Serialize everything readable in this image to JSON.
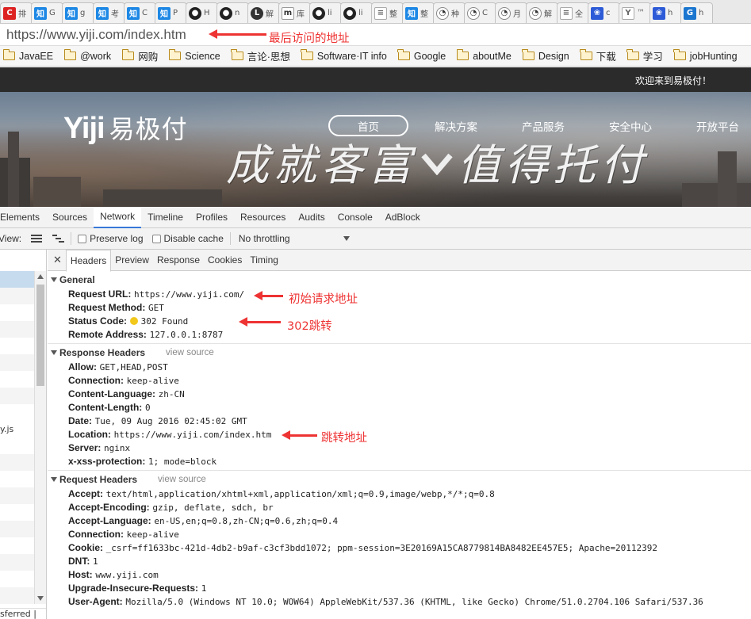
{
  "tabs": [
    {
      "icon": "c-icon",
      "cls": "c",
      "glyph": "C",
      "label": "排"
    },
    {
      "icon": "zhihu-icon",
      "cls": "zh",
      "glyph": "知",
      "label": "G"
    },
    {
      "icon": "zhihu-icon",
      "cls": "zh",
      "glyph": "知",
      "label": "g"
    },
    {
      "icon": "zhihu-icon",
      "cls": "zh",
      "glyph": "知",
      "label": "考"
    },
    {
      "icon": "zhihu-icon",
      "cls": "zh",
      "glyph": "知",
      "label": "C"
    },
    {
      "icon": "zhihu-icon",
      "cls": "zh",
      "glyph": "知",
      "label": "P"
    },
    {
      "icon": "github-icon",
      "cls": "gh",
      "glyph": "●",
      "label": "H"
    },
    {
      "icon": "github-icon",
      "cls": "gh",
      "glyph": "●",
      "label": "n"
    },
    {
      "icon": "l-icon",
      "cls": "l",
      "glyph": "L",
      "label": "解"
    },
    {
      "icon": "m-icon",
      "cls": "m",
      "glyph": "m",
      "label": "库"
    },
    {
      "icon": "github-icon",
      "cls": "gh",
      "glyph": "●",
      "label": "li"
    },
    {
      "icon": "github-icon",
      "cls": "gh",
      "glyph": "●",
      "label": "li"
    },
    {
      "icon": "document-icon",
      "cls": "doc",
      "glyph": "≡",
      "label": "整"
    },
    {
      "icon": "zhihu-icon",
      "cls": "zh",
      "glyph": "知",
      "label": "整"
    },
    {
      "icon": "penguin-icon",
      "cls": "peng",
      "glyph": "◔",
      "label": "种"
    },
    {
      "icon": "penguin-icon",
      "cls": "peng",
      "glyph": "◔",
      "label": "C"
    },
    {
      "icon": "penguin-icon",
      "cls": "peng",
      "glyph": "◔",
      "label": "月"
    },
    {
      "icon": "penguin-icon",
      "cls": "peng",
      "glyph": "◔",
      "label": "解"
    },
    {
      "icon": "document-icon",
      "cls": "doc",
      "glyph": "≡",
      "label": "全"
    },
    {
      "icon": "baidu-icon",
      "cls": "baidu",
      "glyph": "❀",
      "label": "c"
    },
    {
      "icon": "y-icon",
      "cls": "doc",
      "glyph": "Y",
      "label": "™"
    },
    {
      "icon": "baidu-icon",
      "cls": "baidu",
      "glyph": "❀",
      "label": "h"
    },
    {
      "icon": "g-icon",
      "cls": "g",
      "glyph": "G",
      "label": "h"
    }
  ],
  "address": {
    "url": "https://www.yiji.com/index.htm"
  },
  "bookmarks": [
    "JavaEE",
    "@work",
    "网购",
    "Science",
    "言论·思想",
    "Software·IT info",
    "Google",
    "aboutMe",
    "Design",
    "下载",
    "学习",
    "jobHunting"
  ],
  "site": {
    "welcome": "欢迎来到易极付！",
    "logo_latin": "Yiji",
    "logo_cn": "易极付",
    "nav": [
      "首页",
      "解决方案",
      "产品服务",
      "安全中心",
      "开放平台"
    ],
    "slogan_left": "成就客富",
    "slogan_right": "值得托付"
  },
  "devtools": {
    "tabs": [
      "Elements",
      "Sources",
      "Network",
      "Timeline",
      "Profiles",
      "Resources",
      "Audits",
      "Console",
      "AdBlock"
    ],
    "view_label": "View:",
    "preserve_log": "Preserve log",
    "disable_cache": "Disable cache",
    "throttling": "No throttling",
    "left_js": "y.js",
    "left_status": "sferred |",
    "subtabs": [
      "Headers",
      "Preview",
      "Response",
      "Cookies",
      "Timing"
    ],
    "general": {
      "title": "General",
      "rows": [
        {
          "k": "Request URL:",
          "v": "https://www.yiji.com/"
        },
        {
          "k": "Request Method:",
          "v": "GET"
        },
        {
          "k": "Status Code:",
          "v": "302 Found"
        },
        {
          "k": "Remote Address:",
          "v": "127.0.0.1:8787"
        }
      ]
    },
    "response": {
      "title": "Response Headers",
      "view_source": "view source",
      "rows": [
        {
          "k": "Allow:",
          "v": "GET,HEAD,POST"
        },
        {
          "k": "Connection:",
          "v": "keep-alive"
        },
        {
          "k": "Content-Language:",
          "v": "zh-CN"
        },
        {
          "k": "Content-Length:",
          "v": "0"
        },
        {
          "k": "Date:",
          "v": "Tue, 09 Aug 2016 02:45:02 GMT"
        },
        {
          "k": "Location:",
          "v": "https://www.yiji.com/index.htm"
        },
        {
          "k": "Server:",
          "v": "nginx"
        },
        {
          "k": "x-xss-protection:",
          "v": "1; mode=block"
        }
      ]
    },
    "request": {
      "title": "Request Headers",
      "view_source": "view source",
      "rows": [
        {
          "k": "Accept:",
          "v": "text/html,application/xhtml+xml,application/xml;q=0.9,image/webp,*/*;q=0.8"
        },
        {
          "k": "Accept-Encoding:",
          "v": "gzip, deflate, sdch, br"
        },
        {
          "k": "Accept-Language:",
          "v": "en-US,en;q=0.8,zh-CN;q=0.6,zh;q=0.4"
        },
        {
          "k": "Connection:",
          "v": "keep-alive"
        },
        {
          "k": "Cookie:",
          "v": "_csrf=ff1633bc-421d-4db2-b9af-c3cf3bdd1072; ppm-session=3E20169A15CA8779814BA8482EE457E5; Apache=20112392"
        },
        {
          "k": "DNT:",
          "v": "1"
        },
        {
          "k": "Host:",
          "v": "www.yiji.com"
        },
        {
          "k": "Upgrade-Insecure-Requests:",
          "v": "1"
        },
        {
          "k": "User-Agent:",
          "v": "Mozilla/5.0 (Windows NT 10.0; WOW64) AppleWebKit/537.36 (KHTML, like Gecko) Chrome/51.0.2704.106 Safari/537.36"
        }
      ]
    }
  },
  "annotations": {
    "last_visited": "最后访问的地址",
    "initial_request": "初始请求地址",
    "redirect_302": "302跳转",
    "redirect_address": "跳转地址"
  },
  "colors": {
    "annotation": "#e33333",
    "status_dot": "#f2c81c",
    "site_bar": "#2b2b2b",
    "active_tab_underline": "#3879d9"
  }
}
